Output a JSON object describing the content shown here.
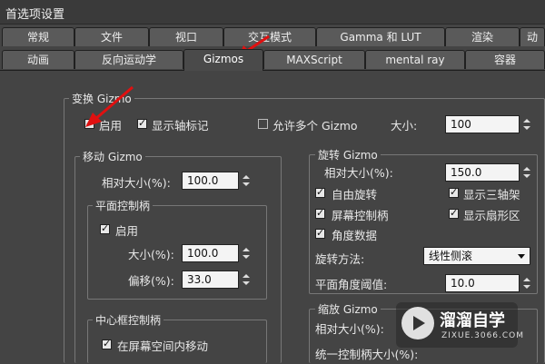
{
  "window": {
    "title": "首选项设置"
  },
  "tabs_row1": [
    "常规",
    "文件",
    "视口",
    "交互模式",
    "Gamma 和 LUT",
    "渲染",
    "动"
  ],
  "tabs_row2": [
    "动画",
    "反向运动学",
    "Gizmos",
    "MAXScript",
    "mental ray",
    "容器"
  ],
  "active_tab": "Gizmos",
  "transform_group": {
    "label": "变换 Gizmo",
    "enable_label": "启用",
    "show_axis_label": "显示轴标记",
    "allow_multiple_label": "允许多个 Gizmo",
    "size_label": "大小:",
    "size_value": "100"
  },
  "move_group": {
    "label": "移动 Gizmo",
    "relative_size_label": "相对大小(%):",
    "relative_size_value": "100.0",
    "plane_handles": {
      "label": "平面控制柄",
      "enable_label": "启用",
      "size_label": "大小(%):",
      "size_value": "100.0",
      "offset_label": "偏移(%):",
      "offset_value": "33.0"
    },
    "center_box": {
      "label": "中心框控制柄",
      "move_screen_label": "在屏幕空间内移动"
    }
  },
  "rotate_group": {
    "label": "旋转 Gizmo",
    "relative_size_label": "相对大小(%):",
    "relative_size_value": "150.0",
    "free_rotate_label": "自由旋转",
    "show_tri_axis_label": "显示三轴架",
    "screen_handle_label": "屏幕控制柄",
    "show_sector_label": "显示扇形区",
    "angle_data_label": "角度数据",
    "method_label": "旋转方法:",
    "method_value": "线性侧滚",
    "plane_threshold_label": "平面角度阈值:",
    "plane_threshold_value": "10.0"
  },
  "scale_group": {
    "label": "缩放 Gizmo",
    "relative_size_label": "相对大小(%):",
    "uniform_handle_label": "统一控制柄大小(%):"
  },
  "watermark": {
    "brand": "溜溜自学",
    "url": "ZIXUE.3066.COM"
  }
}
